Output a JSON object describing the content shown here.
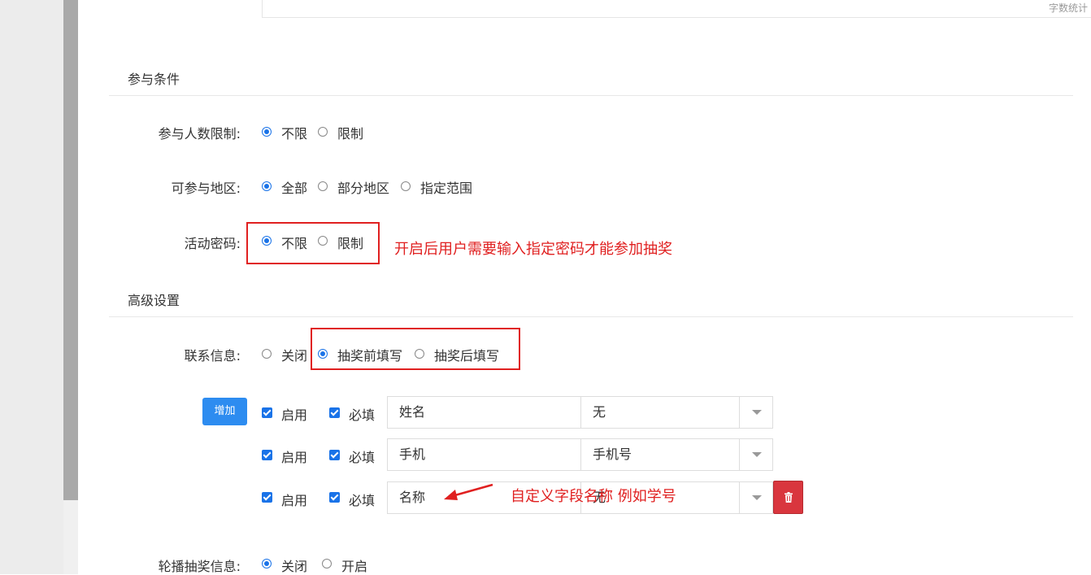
{
  "editor": {
    "word_count_label": "字数统计"
  },
  "sections": {
    "participation_title": "参与条件",
    "advanced_title": "高级设置"
  },
  "rows": {
    "participant_limit": {
      "label": "参与人数限制:",
      "options": [
        "不限",
        "限制"
      ],
      "selected": "不限"
    },
    "region": {
      "label": "可参与地区:",
      "options": [
        "全部",
        "部分地区",
        "指定范围"
      ],
      "selected": "全部"
    },
    "password": {
      "label": "活动密码:",
      "options": [
        "不限",
        "限制"
      ],
      "selected": "不限"
    },
    "contact": {
      "label": "联系信息:",
      "options": [
        "关闭",
        "抽奖前填写",
        "抽奖后填写"
      ],
      "selected": "抽奖前填写"
    },
    "carousel": {
      "label": "轮播抽奖信息:",
      "options": [
        "关闭",
        "开启"
      ],
      "selected": "关闭"
    }
  },
  "contact_fields": {
    "add_label": "增加",
    "enable_label": "启用",
    "required_label": "必填",
    "items": [
      {
        "name": "姓名",
        "type": "无",
        "enabled": true,
        "required": true
      },
      {
        "name": "手机",
        "type": "手机号",
        "enabled": true,
        "required": true
      },
      {
        "name": "名称",
        "type": "无",
        "enabled": true,
        "required": true
      }
    ]
  },
  "annotations": {
    "password_note": "开启后用户需要输入指定密码才能参加抽奖",
    "custom_field_note": "自定义字段名称 例如学号"
  },
  "colors": {
    "accent": "#1a73e8",
    "annotation": "#e02020",
    "add_button": "#2d8cf0",
    "delete_button": "#d9363e"
  },
  "icons": {
    "delete": "trash-icon",
    "dropdown": "caret-down-icon"
  }
}
